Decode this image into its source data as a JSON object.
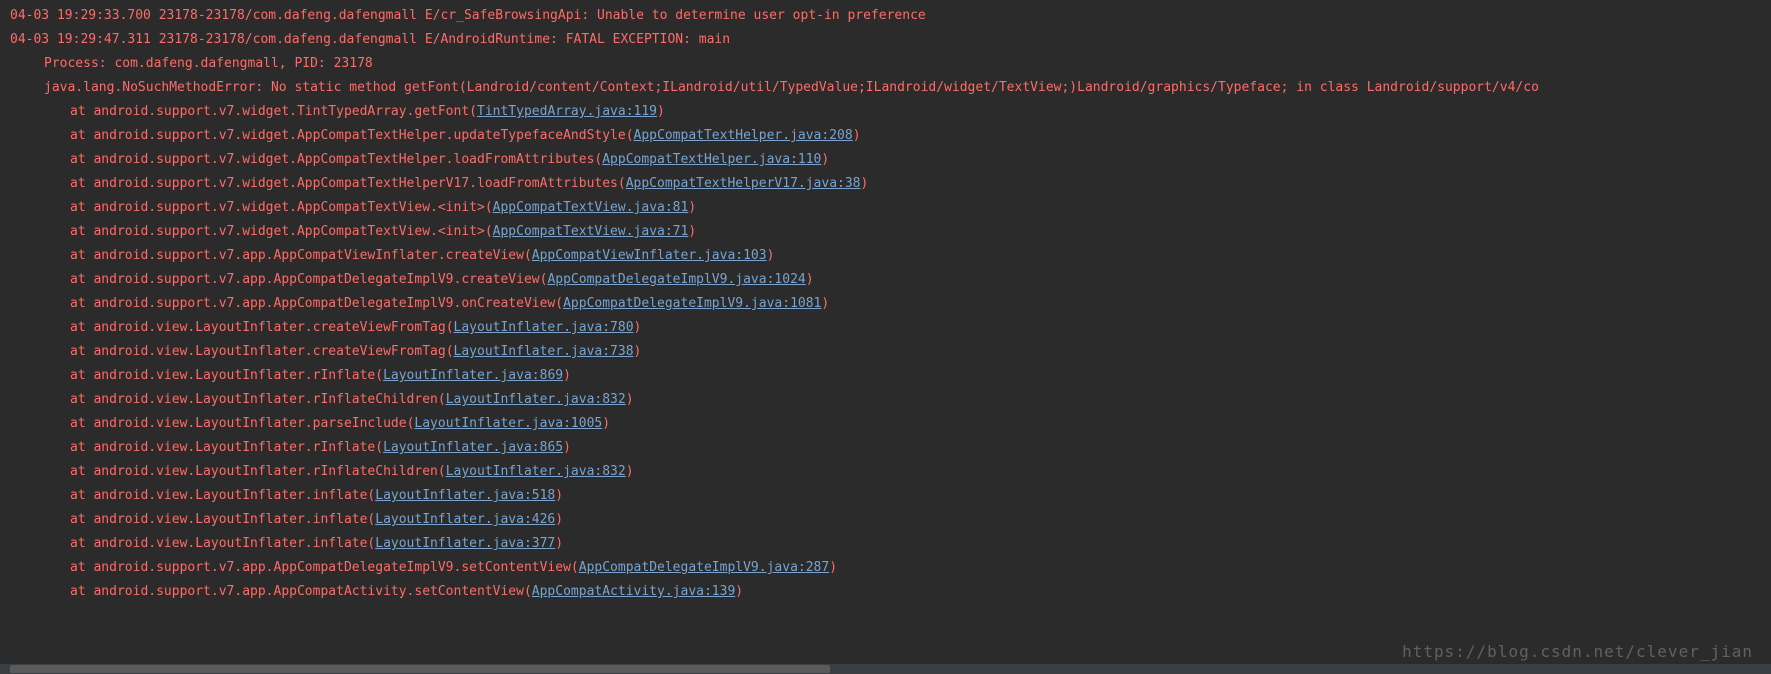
{
  "lines": [
    {
      "ts": "04-03 19:29:33.700",
      "pidtid": "23178-23178",
      "pkg": "com.dafeng.dafengmall",
      "lvl": "E",
      "tag": "cr_SafeBrowsingApi",
      "msg": "Unable to determine user opt-in preference",
      "kind": "header"
    },
    {
      "ts": "04-03 19:29:47.311",
      "pidtid": "23178-23178",
      "pkg": "com.dafeng.dafengmall",
      "lvl": "E",
      "tag": "AndroidRuntime",
      "msg": "FATAL EXCEPTION: main",
      "kind": "header"
    },
    {
      "kind": "plain",
      "indent": 1,
      "text": "Process: com.dafeng.dafengmall, PID: 23178"
    },
    {
      "kind": "plain",
      "indent": 1,
      "text": "java.lang.NoSuchMethodError: No static method getFont(Landroid/content/Context;ILandroid/util/TypedValue;ILandroid/widget/TextView;)Landroid/graphics/Typeface; in class Landroid/support/v4/co"
    },
    {
      "kind": "at",
      "call": "android.support.v7.widget.TintTypedArray.getFont",
      "link": "TintTypedArray.java:119"
    },
    {
      "kind": "at",
      "call": "android.support.v7.widget.AppCompatTextHelper.updateTypefaceAndStyle",
      "link": "AppCompatTextHelper.java:208"
    },
    {
      "kind": "at",
      "call": "android.support.v7.widget.AppCompatTextHelper.loadFromAttributes",
      "link": "AppCompatTextHelper.java:110"
    },
    {
      "kind": "at",
      "call": "android.support.v7.widget.AppCompatTextHelperV17.loadFromAttributes",
      "link": "AppCompatTextHelperV17.java:38"
    },
    {
      "kind": "at",
      "call": "android.support.v7.widget.AppCompatTextView.<init>",
      "link": "AppCompatTextView.java:81"
    },
    {
      "kind": "at",
      "call": "android.support.v7.widget.AppCompatTextView.<init>",
      "link": "AppCompatTextView.java:71"
    },
    {
      "kind": "at",
      "call": "android.support.v7.app.AppCompatViewInflater.createView",
      "link": "AppCompatViewInflater.java:103"
    },
    {
      "kind": "at",
      "call": "android.support.v7.app.AppCompatDelegateImplV9.createView",
      "link": "AppCompatDelegateImplV9.java:1024"
    },
    {
      "kind": "at",
      "call": "android.support.v7.app.AppCompatDelegateImplV9.onCreateView",
      "link": "AppCompatDelegateImplV9.java:1081"
    },
    {
      "kind": "at",
      "call": "android.view.LayoutInflater.createViewFromTag",
      "link": "LayoutInflater.java:780"
    },
    {
      "kind": "at",
      "call": "android.view.LayoutInflater.createViewFromTag",
      "link": "LayoutInflater.java:738"
    },
    {
      "kind": "at",
      "call": "android.view.LayoutInflater.rInflate",
      "link": "LayoutInflater.java:869"
    },
    {
      "kind": "at",
      "call": "android.view.LayoutInflater.rInflateChildren",
      "link": "LayoutInflater.java:832"
    },
    {
      "kind": "at",
      "call": "android.view.LayoutInflater.parseInclude",
      "link": "LayoutInflater.java:1005"
    },
    {
      "kind": "at",
      "call": "android.view.LayoutInflater.rInflate",
      "link": "LayoutInflater.java:865"
    },
    {
      "kind": "at",
      "call": "android.view.LayoutInflater.rInflateChildren",
      "link": "LayoutInflater.java:832"
    },
    {
      "kind": "at",
      "call": "android.view.LayoutInflater.inflate",
      "link": "LayoutInflater.java:518"
    },
    {
      "kind": "at",
      "call": "android.view.LayoutInflater.inflate",
      "link": "LayoutInflater.java:426"
    },
    {
      "kind": "at",
      "call": "android.view.LayoutInflater.inflate",
      "link": "LayoutInflater.java:377"
    },
    {
      "kind": "at",
      "call": "android.support.v7.app.AppCompatDelegateImplV9.setContentView",
      "link": "AppCompatDelegateImplV9.java:287"
    },
    {
      "kind": "at",
      "call": "android.support.v7.app.AppCompatActivity.setContentView",
      "link": "AppCompatActivity.java:139"
    }
  ],
  "watermark": "https://blog.csdn.net/clever_jian"
}
